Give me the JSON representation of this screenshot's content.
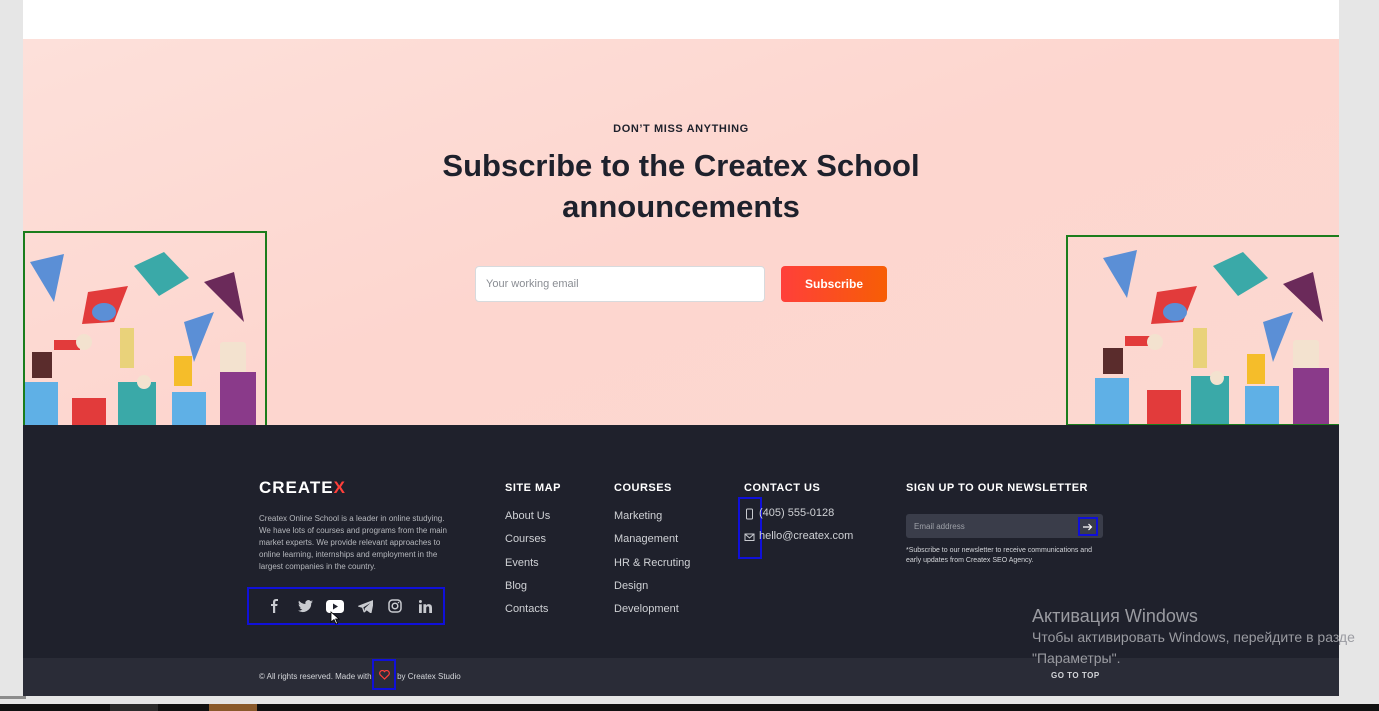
{
  "hero": {
    "eyebrow": "DON’T MISS ANYTHING",
    "title": "Subscribe to the Createx School announcements",
    "email_placeholder": "Your working email",
    "subscribe_label": "Subscribe"
  },
  "footer": {
    "brand": "CREATE",
    "brand_accent": "X",
    "about": "Createx Online School is a leader in online studying. We have lots of courses and programs from the main market experts. We provide relevant approaches to online learning, internships and employment in the largest companies in the country.",
    "social": [
      "facebook-icon",
      "twitter-icon",
      "youtube-icon",
      "telegram-icon",
      "instagram-icon",
      "linkedin-icon"
    ],
    "sitemap": {
      "title": "SITE MAP",
      "items": [
        "About Us",
        "Courses",
        "Events",
        "Blog",
        "Contacts"
      ]
    },
    "courses": {
      "title": "COURSES",
      "items": [
        "Marketing",
        "Management",
        "HR & Recruting",
        "Design",
        "Development"
      ]
    },
    "contact": {
      "title": "CONTACT US",
      "phone": "(405) 555-0128",
      "email": "hello@createx.com"
    },
    "newsletter": {
      "title": "SIGN UP TO OUR NEWSLETTER",
      "placeholder": "Email address",
      "note": "*Subscribe to our newsletter to receive communications and early updates from Createx SEO Agency."
    },
    "bottom": {
      "copyright_prefix": "© All rights reserved. Made with",
      "copyright_suffix": "by Createx Studio",
      "go_top": "GO TO TOP"
    }
  },
  "windows_watermark": {
    "title": "Активация Windows",
    "line1": "Чтобы активировать Windows, перейдите в разде",
    "line2": "\"Параметры\"."
  },
  "colors": {
    "accent": "#ff3f3a",
    "footer_bg": "#1f212c",
    "hero_bg": "#fdd9d2",
    "annotation_green": "#1c7d1c",
    "annotation_blue": "#1010d8"
  }
}
